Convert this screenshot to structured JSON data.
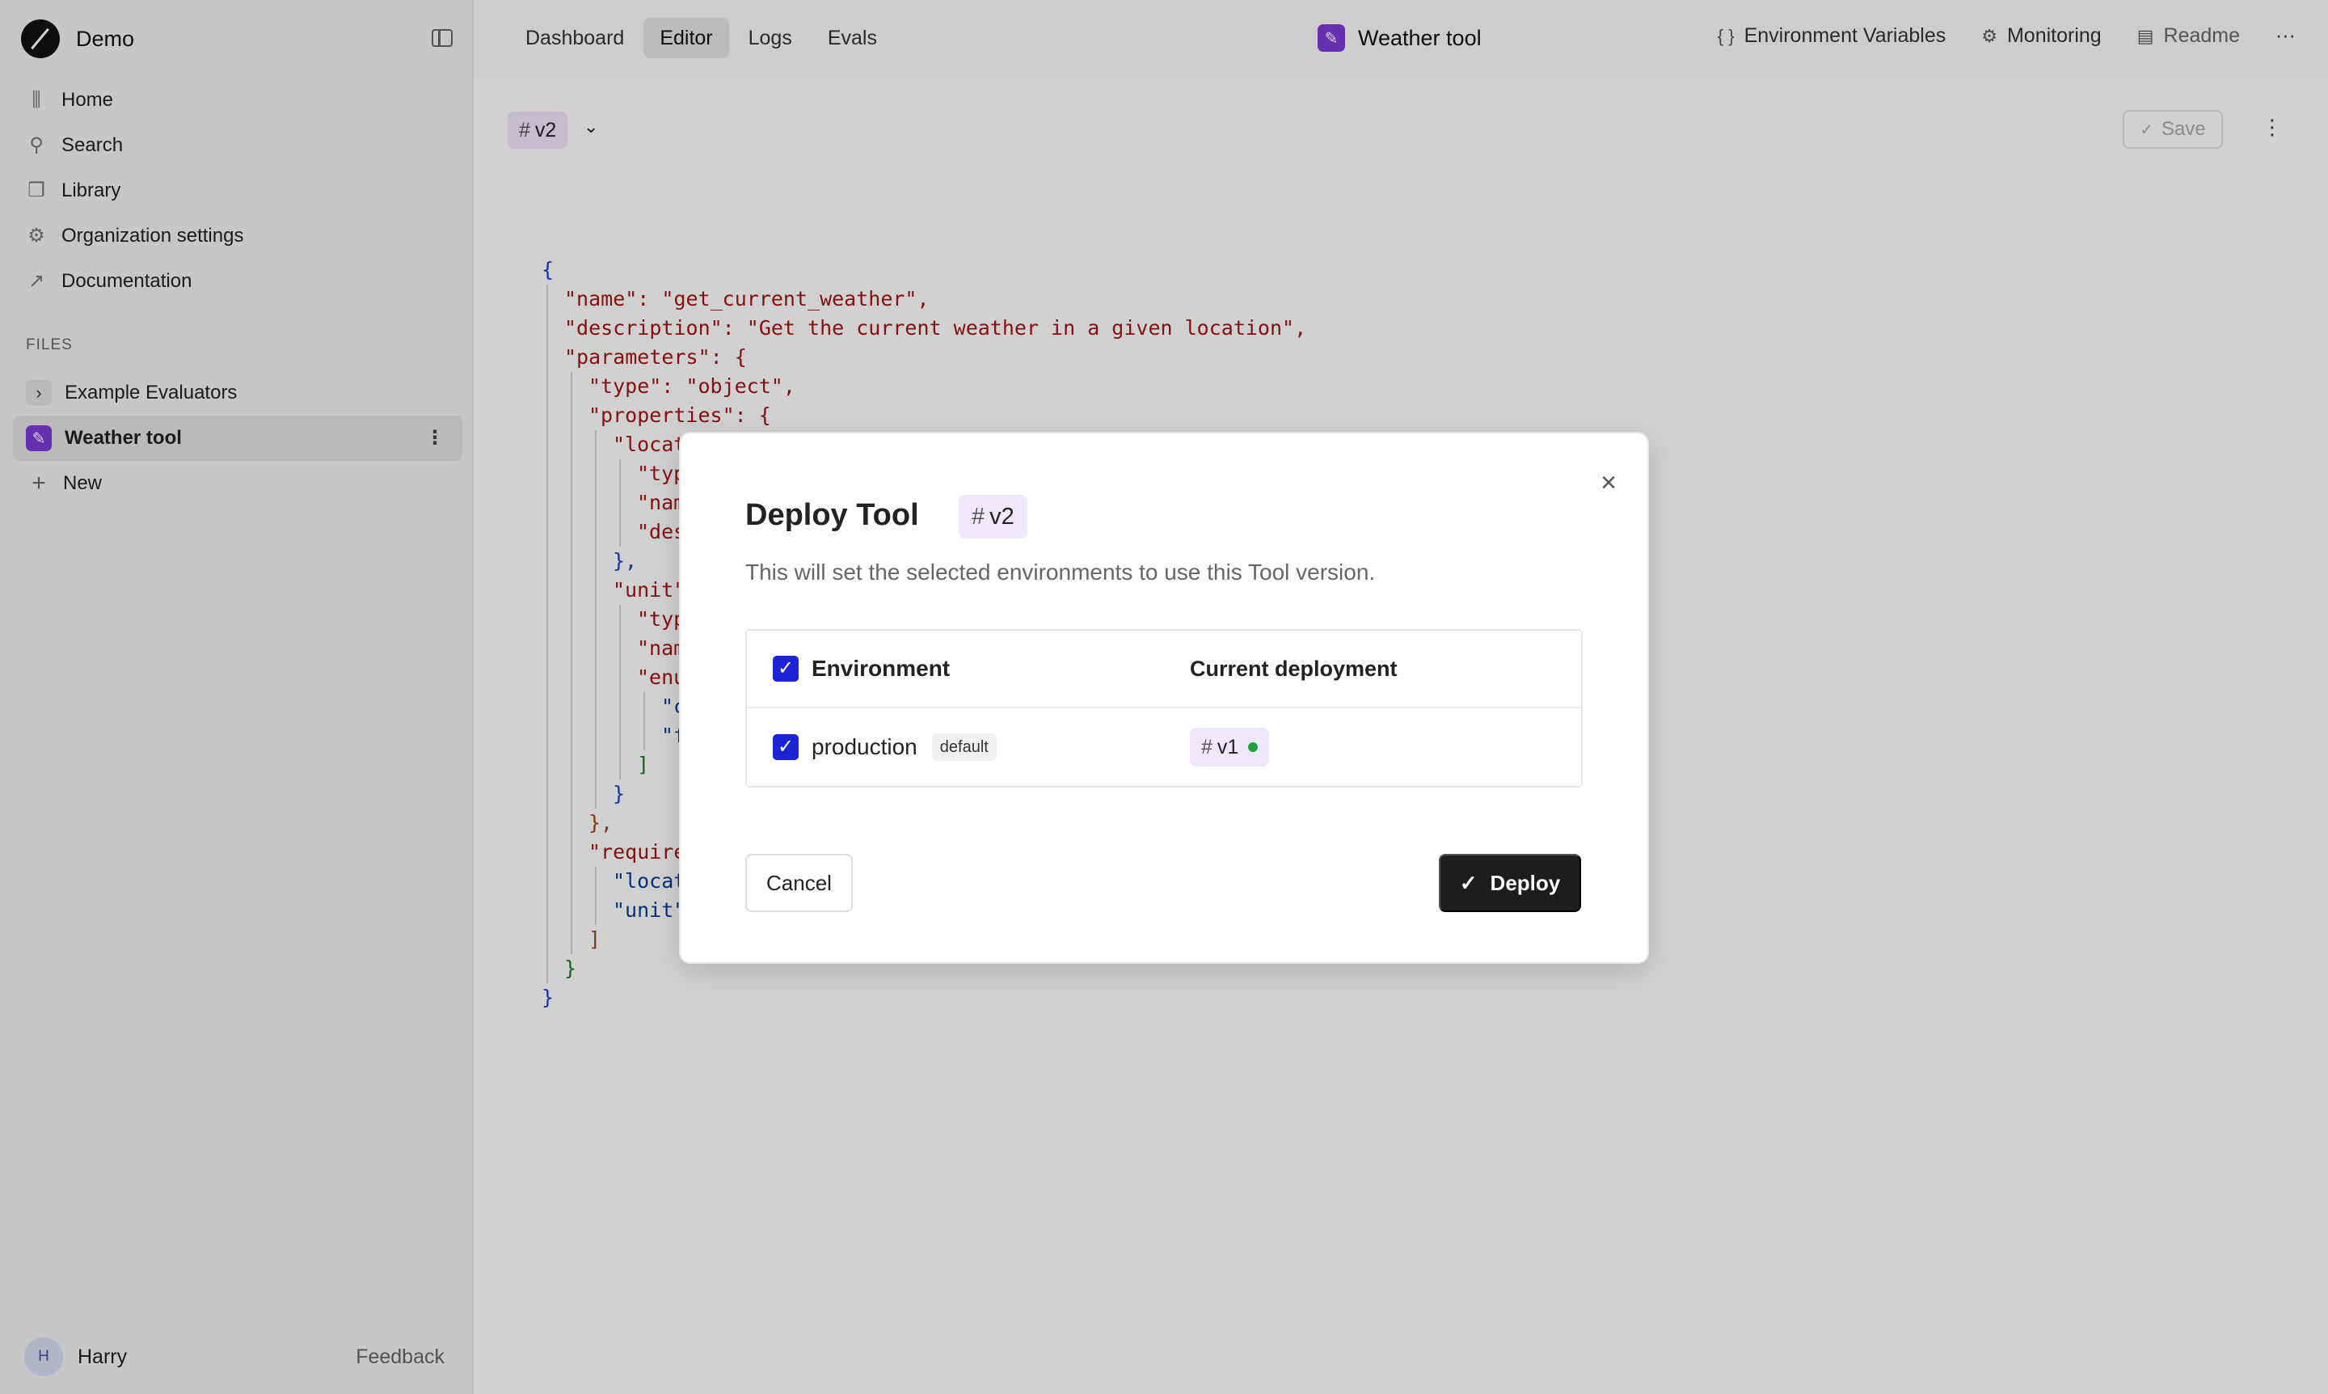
{
  "sidebar": {
    "brand": "Demo",
    "nav": [
      {
        "label": "Home",
        "icon": "home-icon",
        "glyph": "⫼"
      },
      {
        "label": "Search",
        "icon": "search-icon",
        "glyph": "⚲"
      },
      {
        "label": "Library",
        "icon": "book-icon",
        "glyph": "❒"
      },
      {
        "label": "Organization settings",
        "icon": "gear-icon",
        "glyph": "⚙"
      },
      {
        "label": "Documentation",
        "icon": "external-link-icon",
        "glyph": "↗"
      }
    ],
    "files_label": "FILES",
    "files": [
      {
        "label": "Example Evaluators"
      },
      {
        "label": "Weather tool"
      },
      {
        "label": "New"
      }
    ],
    "user": {
      "initial": "H",
      "name": "Harry"
    },
    "feedback": "Feedback"
  },
  "topbar": {
    "tabs": [
      "Dashboard",
      "Editor",
      "Logs",
      "Evals"
    ],
    "active_tab": "Editor",
    "title": "Weather tool",
    "right": [
      {
        "label": "Environment Variables",
        "glyph": "{ }"
      },
      {
        "label": "Monitoring",
        "glyph": "⚙"
      },
      {
        "label": "Readme",
        "glyph": "▤"
      }
    ],
    "more": "···"
  },
  "editor": {
    "version": "v2",
    "save_label": "Save",
    "code_lines": [
      "{",
      "\"name\": \"get_current_weather\",",
      "\"description\": \"Get the current weather in a given location\",",
      "\"parameters\": {",
      "\"type\": \"object\",",
      "\"properties\": {",
      "\"locat",
      "\"typ",
      "\"nam",
      "\"des",
      "},",
      "\"unit\"",
      "\"typ",
      "\"nam",
      "\"enu",
      "\"c",
      "\"f",
      "]",
      "}",
      "},",
      "\"require",
      "\"locat",
      "\"unit\"",
      "]",
      "}",
      "}"
    ]
  },
  "modal": {
    "title": "Deploy Tool",
    "version": "v2",
    "description": "This will set the selected environments to use this Tool version.",
    "table": {
      "col_environment": "Environment",
      "col_current": "Current deployment",
      "rows": [
        {
          "environment": "production",
          "tag": "default",
          "current": "v1",
          "status_color": "#1fa13a"
        }
      ]
    },
    "cancel_label": "Cancel",
    "deploy_label": "Deploy"
  },
  "colors": {
    "accent": "#1c22d6",
    "tool_badge": "#7e3bd8",
    "version_chip": "#efe7fb",
    "primary_button": "#1d1d1d"
  }
}
